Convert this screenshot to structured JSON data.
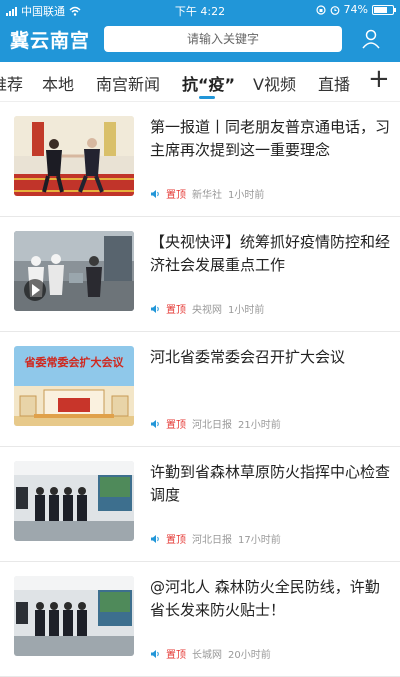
{
  "status_bar": {
    "carrier": "中国联通",
    "time": "下午 4:22",
    "battery": "74%",
    "battery_level": 0.74
  },
  "header": {
    "logo": "冀云南宫",
    "search_placeholder": "请输入关键字"
  },
  "tabs": [
    "推荐",
    "本地",
    "南宫新闻",
    "抗“疫”",
    "V视频",
    "直播"
  ],
  "tabs_plus": "+",
  "banner_text": "省委常委会扩大会议",
  "news": [
    {
      "title": "第一报道丨同老朋友普京通电话，习主席再次提到这一重要理念",
      "pin": "置顶",
      "source": "新华社",
      "time": "1小时前"
    },
    {
      "title": "【央视快评】统筹抓好疫情防控和经济社会发展重点工作",
      "pin": "置顶",
      "source": "央视网",
      "time": "1小时前"
    },
    {
      "title": "河北省委常委会召开扩大会议",
      "pin": "置顶",
      "source": "河北日报",
      "time": "21小时前"
    },
    {
      "title": "许勤到省森林草原防火指挥中心检查调度",
      "pin": "置顶",
      "source": "河北日报",
      "time": "17小时前"
    },
    {
      "title": "@河北人 森林防火全民防线，许勤省长发来防火贴士！",
      "pin": "置顶",
      "source": "长城网",
      "time": "20小时前"
    }
  ],
  "colors": {
    "header": "#2196d8",
    "pin": "#e53935"
  }
}
